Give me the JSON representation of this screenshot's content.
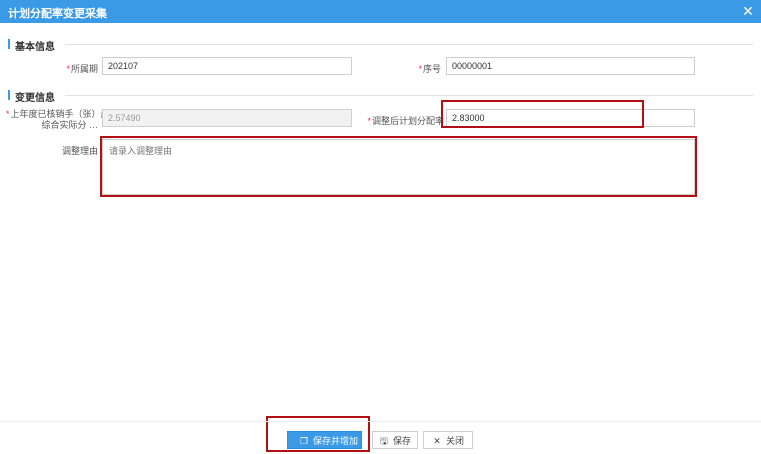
{
  "dialog": {
    "title": "计划分配率变更采集",
    "close_icon": "✕"
  },
  "sections": {
    "basic": "基本信息",
    "change": "变更信息"
  },
  "fields": {
    "period": {
      "label": "所属期",
      "value": "202107"
    },
    "serial": {
      "label": "序号",
      "value": "00000001"
    },
    "prev_rate": {
      "label_line1": "上年度已核销手（张）册",
      "label_line2": "综合实际分",
      "value": "2.57490"
    },
    "adjusted_rate": {
      "label": "调整后计划分配率",
      "value": "2.83000"
    },
    "reason": {
      "label": "调整理由",
      "placeholder": "请录入调整理由"
    }
  },
  "footer": {
    "save_add_label": "保存并增加",
    "save_label": "保存",
    "close_label": "关闭"
  },
  "colors": {
    "accent": "#3a9ae6",
    "callout": "#b31016",
    "required": "#e33333"
  }
}
